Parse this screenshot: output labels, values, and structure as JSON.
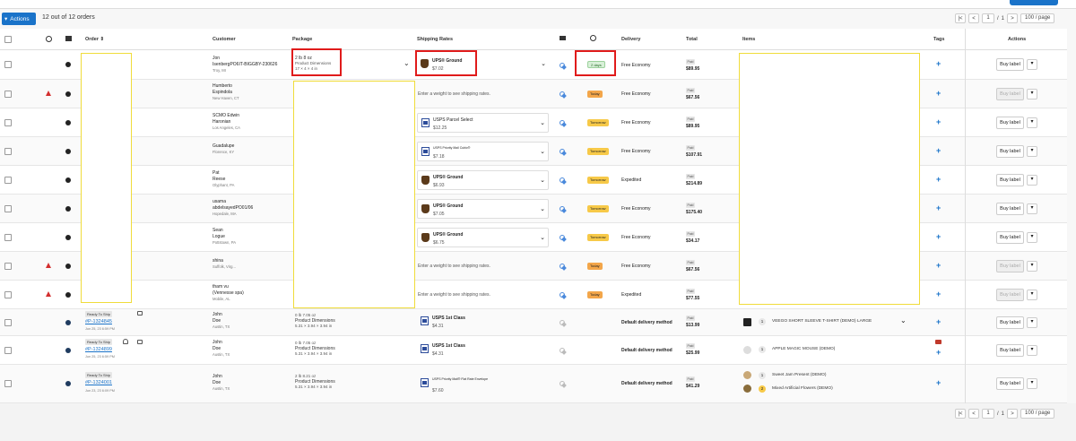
{
  "toolbar": {
    "actions_label": "Actions",
    "order_count": "12 out of 12 orders"
  },
  "pager": {
    "page": "1",
    "of": "/",
    "total_pages": "1",
    "per_page": "100 / page"
  },
  "columns": {
    "order": "Order",
    "customer": "Customer",
    "package": "Package",
    "shipping_rates": "Shipping Rates",
    "delivery": "Delivery",
    "total": "Total",
    "items": "Items",
    "tags": "Tags",
    "actions": "Actions"
  },
  "rows": [
    {
      "name": "Jon",
      "name2": "IsenbergPO6IT-BIGGBY-230626",
      "loc": "Troy, MI",
      "pkg1": "2 lb 8 oz",
      "pkg2": "Product Dimensions",
      "pkg3": "17 × 4 × 4 in",
      "rate": "UPS® Ground",
      "price": "$7.02",
      "badge": "2 days",
      "delivery": "Free Economy",
      "paid": "Paid",
      "total": "$89.95",
      "buy": "Buy label"
    },
    {
      "name": "Humberto",
      "name2": "Espindola",
      "loc": "New Haven, CT",
      "msg": "Enter a weight to see shipping rates.",
      "badge": "Today",
      "delivery": "Free Economy",
      "paid": "Paid",
      "total": "$67.56",
      "buy": "Buy label"
    },
    {
      "name": "SCMO Edwin",
      "name2": "Haronian",
      "loc": "Los Angeles, CA",
      "rate": "USPS Parcel Select",
      "price": "$12.25",
      "badge": "Tomorrow",
      "delivery": "Free Economy",
      "paid": "Paid",
      "total": "$89.95",
      "buy": "Buy label"
    },
    {
      "name": "Guadalupe",
      "name2": "",
      "loc": "Florence, KY",
      "rate": "USPS Priority Mail Cubic®",
      "price": "$7.18",
      "badge": "Tomorrow",
      "delivery": "Free Economy",
      "paid": "Paid",
      "total": "$107.91",
      "buy": "Buy label"
    },
    {
      "name": "Pat",
      "name2": "Reese",
      "loc": "Olyphant, PA",
      "rate": "UPS® Ground",
      "price": "$6.93",
      "badge": "Tomorrow",
      "delivery": "Expedited",
      "paid": "Paid",
      "total": "$214.89",
      "buy": "Buy label"
    },
    {
      "name": "usama",
      "name2": "abdelsayedPO01/06",
      "loc": "Hopedale, MA",
      "rate": "UPS® Ground",
      "price": "$7.05",
      "badge": "Tomorrow",
      "delivery": "Free Economy",
      "paid": "Paid",
      "total": "$175.40",
      "buy": "Buy label"
    },
    {
      "name": "Sean",
      "name2": "Logue",
      "loc": "Pottstown, PA",
      "rate": "UPS® Ground",
      "price": "$6.75",
      "badge": "Tomorrow",
      "delivery": "Free Economy",
      "paid": "Paid",
      "total": "$34.17",
      "buy": "Buy label"
    },
    {
      "name": "shina",
      "name2": "",
      "loc": "Suffolk, Virg...",
      "msg": "Enter a weight to see shipping rates.",
      "badge": "Today",
      "delivery": "Free Economy",
      "paid": "Paid",
      "total": "$67.56",
      "buy": "Buy label"
    },
    {
      "name": "tham vu",
      "name2": "(Vennesse spa)",
      "loc": "Mobile, AL",
      "msg": "Enter a weight to see shipping rates.",
      "badge": "Today",
      "delivery": "Expedited",
      "paid": "Paid",
      "total": "$77.55",
      "buy": "Buy label"
    },
    {
      "status": "Ready To Ship",
      "order": "#P-1324845",
      "date": "Jun 25, 23 6:59 PM",
      "name": "John",
      "name2": "Doe",
      "loc": "Austin, TX",
      "pkg1": "0 lb 7.05 oz",
      "pkg2": "Product Dimensions",
      "pkg3": "5.31 × 3.94 × 3.94 in",
      "rate": "USPS 1st Class",
      "price": "$4.31",
      "delivery": "Default delivery method",
      "paid": "Paid",
      "total": "$13.99",
      "items": [
        {
          "qty": "1",
          "name": "VEEGO SHORT SLEEVE T-SHIRT (DEMO) LARGE"
        }
      ],
      "buy": "Buy label"
    },
    {
      "status": "Ready To Ship",
      "order": "#P-1324899",
      "date": "Jun 25, 23 6:59 PM",
      "name": "John",
      "name2": "Doe",
      "loc": "Austin, TX",
      "pkg1": "0 lb 7.05 oz",
      "pkg2": "Product Dimensions",
      "pkg3": "5.31 × 3.94 × 3.94 in",
      "rate": "USPS 1st Class",
      "price": "$4.31",
      "delivery": "Default delivery method",
      "paid": "Paid",
      "total": "$25.99",
      "items": [
        {
          "qty": "1",
          "name": "APPLE MAGIC MOUSE (DEMO)"
        }
      ],
      "buy": "Buy label"
    },
    {
      "status": "Ready To Ship",
      "order": "#P-1324001",
      "date": "Jun 23, 23 6:09 PM",
      "name": "John",
      "name2": "Doe",
      "loc": "Austin, TX",
      "pkg1": "2 lb 8.21 oz",
      "pkg2": "Product Dimensions",
      "pkg3": "5.31 × 3.94 × 3.94 in",
      "rate": "USPS Priority Mail® Flat Rate Envelope",
      "price": "$7.60",
      "delivery": "Default delivery method",
      "paid": "Paid",
      "total": "$41.29",
      "items": [
        {
          "qty": "1",
          "name": "Sweet Jam Present (DEMO)"
        },
        {
          "qty": "2",
          "name": "Mixed Artificial Flowers (DEMO)"
        }
      ],
      "buy": "Buy label"
    }
  ]
}
